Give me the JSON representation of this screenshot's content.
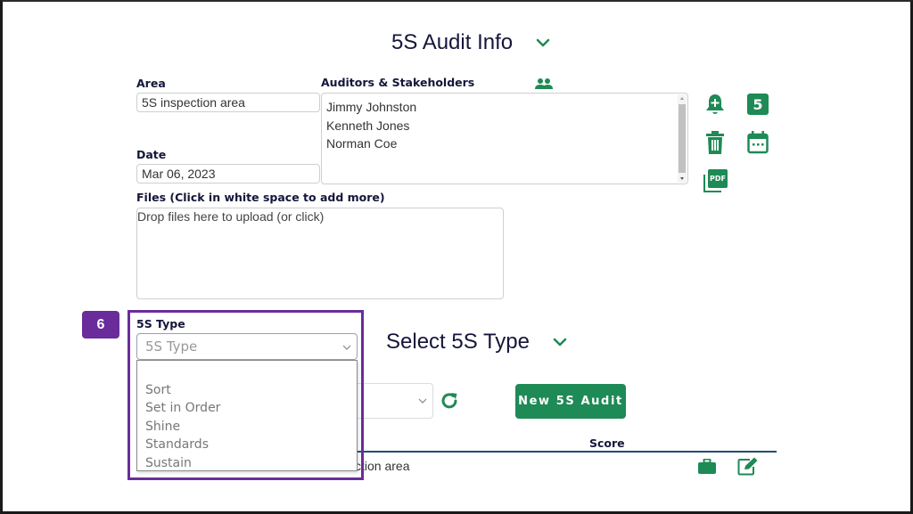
{
  "audit_info": {
    "title": "5S Audit Info",
    "chevron_icon": "chevron-down-icon",
    "area": {
      "label": "Area",
      "value": "5S inspection area"
    },
    "date": {
      "label": "Date",
      "value": "Mar 06, 2023"
    },
    "auditors": {
      "label": "Auditors & Stakeholders",
      "icon": "people-icon",
      "names": [
        "Jimmy Johnston",
        "Kenneth Jones",
        "Norman Coe"
      ]
    },
    "files": {
      "label": "Files (Click in white space to add more)",
      "dropzone_text": "Drop files here to upload (or click)"
    },
    "actions": [
      {
        "name": "add-reminder",
        "icon": "bell-plus-icon"
      },
      {
        "name": "five-s",
        "icon": "five-badge-icon",
        "text": "5"
      },
      {
        "name": "delete",
        "icon": "trash-icon"
      },
      {
        "name": "calendar",
        "icon": "calendar-icon"
      },
      {
        "name": "pdf",
        "icon": "pdf-icon",
        "text": "PDF"
      }
    ]
  },
  "five_s_type": {
    "label": "5S Type",
    "placeholder": "5S Type",
    "options": [
      "",
      "Sort",
      "Set in Order",
      "Shine",
      "Standards",
      "Sustain"
    ]
  },
  "select_type": {
    "title": "Select 5S Type",
    "new_audit_button": "New 5S Audit",
    "refresh_icon": "refresh-icon"
  },
  "table": {
    "columns": [
      "Score"
    ],
    "rows": [
      {
        "area_partial": "ction area",
        "icons": [
          "briefcase-icon",
          "edit-icon"
        ]
      }
    ]
  },
  "callout": {
    "number": "6",
    "color": "#6a2c9a"
  },
  "colors": {
    "accent": "#1e8a55",
    "title": "#14163a",
    "callout": "#6a2c9a",
    "table_rule": "#1f4e79"
  }
}
